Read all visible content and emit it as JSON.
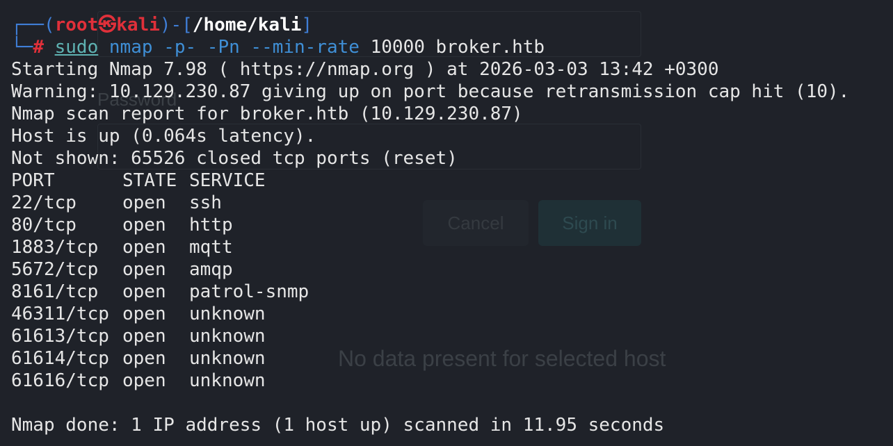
{
  "ghost": {
    "password_label": "Password",
    "cancel": "Cancel",
    "sign_in": "Sign in",
    "no_data": "No data present for selected host"
  },
  "prompt": {
    "open_paren": "(",
    "user": "root",
    "at": "㉿",
    "host": "kali",
    "close_paren": ")",
    "dir_open": "-[",
    "dir": "/home/kali",
    "dir_close": "]",
    "hash": "#",
    "cmd_sudo": "sudo",
    "cmd_nmap": "nmap",
    "cmd_args": "-p- -Pn --min-rate",
    "cmd_rest": "10000 broker.htb"
  },
  "output": {
    "line1": "Starting Nmap 7.98 ( https://nmap.org ) at 2026-03-03 13:42 +0300",
    "line2": "Warning: 10.129.230.87 giving up on port because retransmission cap hit (10).",
    "line3": "Nmap scan report for broker.htb (10.129.230.87)",
    "line4": "Host is up (0.064s latency).",
    "line5": "Not shown: 65526 closed tcp ports (reset)",
    "header": {
      "port": "PORT",
      "state": "STATE",
      "service": "SERVICE"
    },
    "ports": [
      {
        "port": "22/tcp",
        "state": "open",
        "service": "ssh"
      },
      {
        "port": "80/tcp",
        "state": "open",
        "service": "http"
      },
      {
        "port": "1883/tcp",
        "state": "open",
        "service": "mqtt"
      },
      {
        "port": "5672/tcp",
        "state": "open",
        "service": "amqp"
      },
      {
        "port": "8161/tcp",
        "state": "open",
        "service": "patrol-snmp"
      },
      {
        "port": "46311/tcp",
        "state": "open",
        "service": "unknown"
      },
      {
        "port": "61613/tcp",
        "state": "open",
        "service": "unknown"
      },
      {
        "port": "61614/tcp",
        "state": "open",
        "service": "unknown"
      },
      {
        "port": "61616/tcp",
        "state": "open",
        "service": "unknown"
      }
    ],
    "done": "Nmap done: 1 IP address (1 host up) scanned in 11.95 seconds"
  }
}
